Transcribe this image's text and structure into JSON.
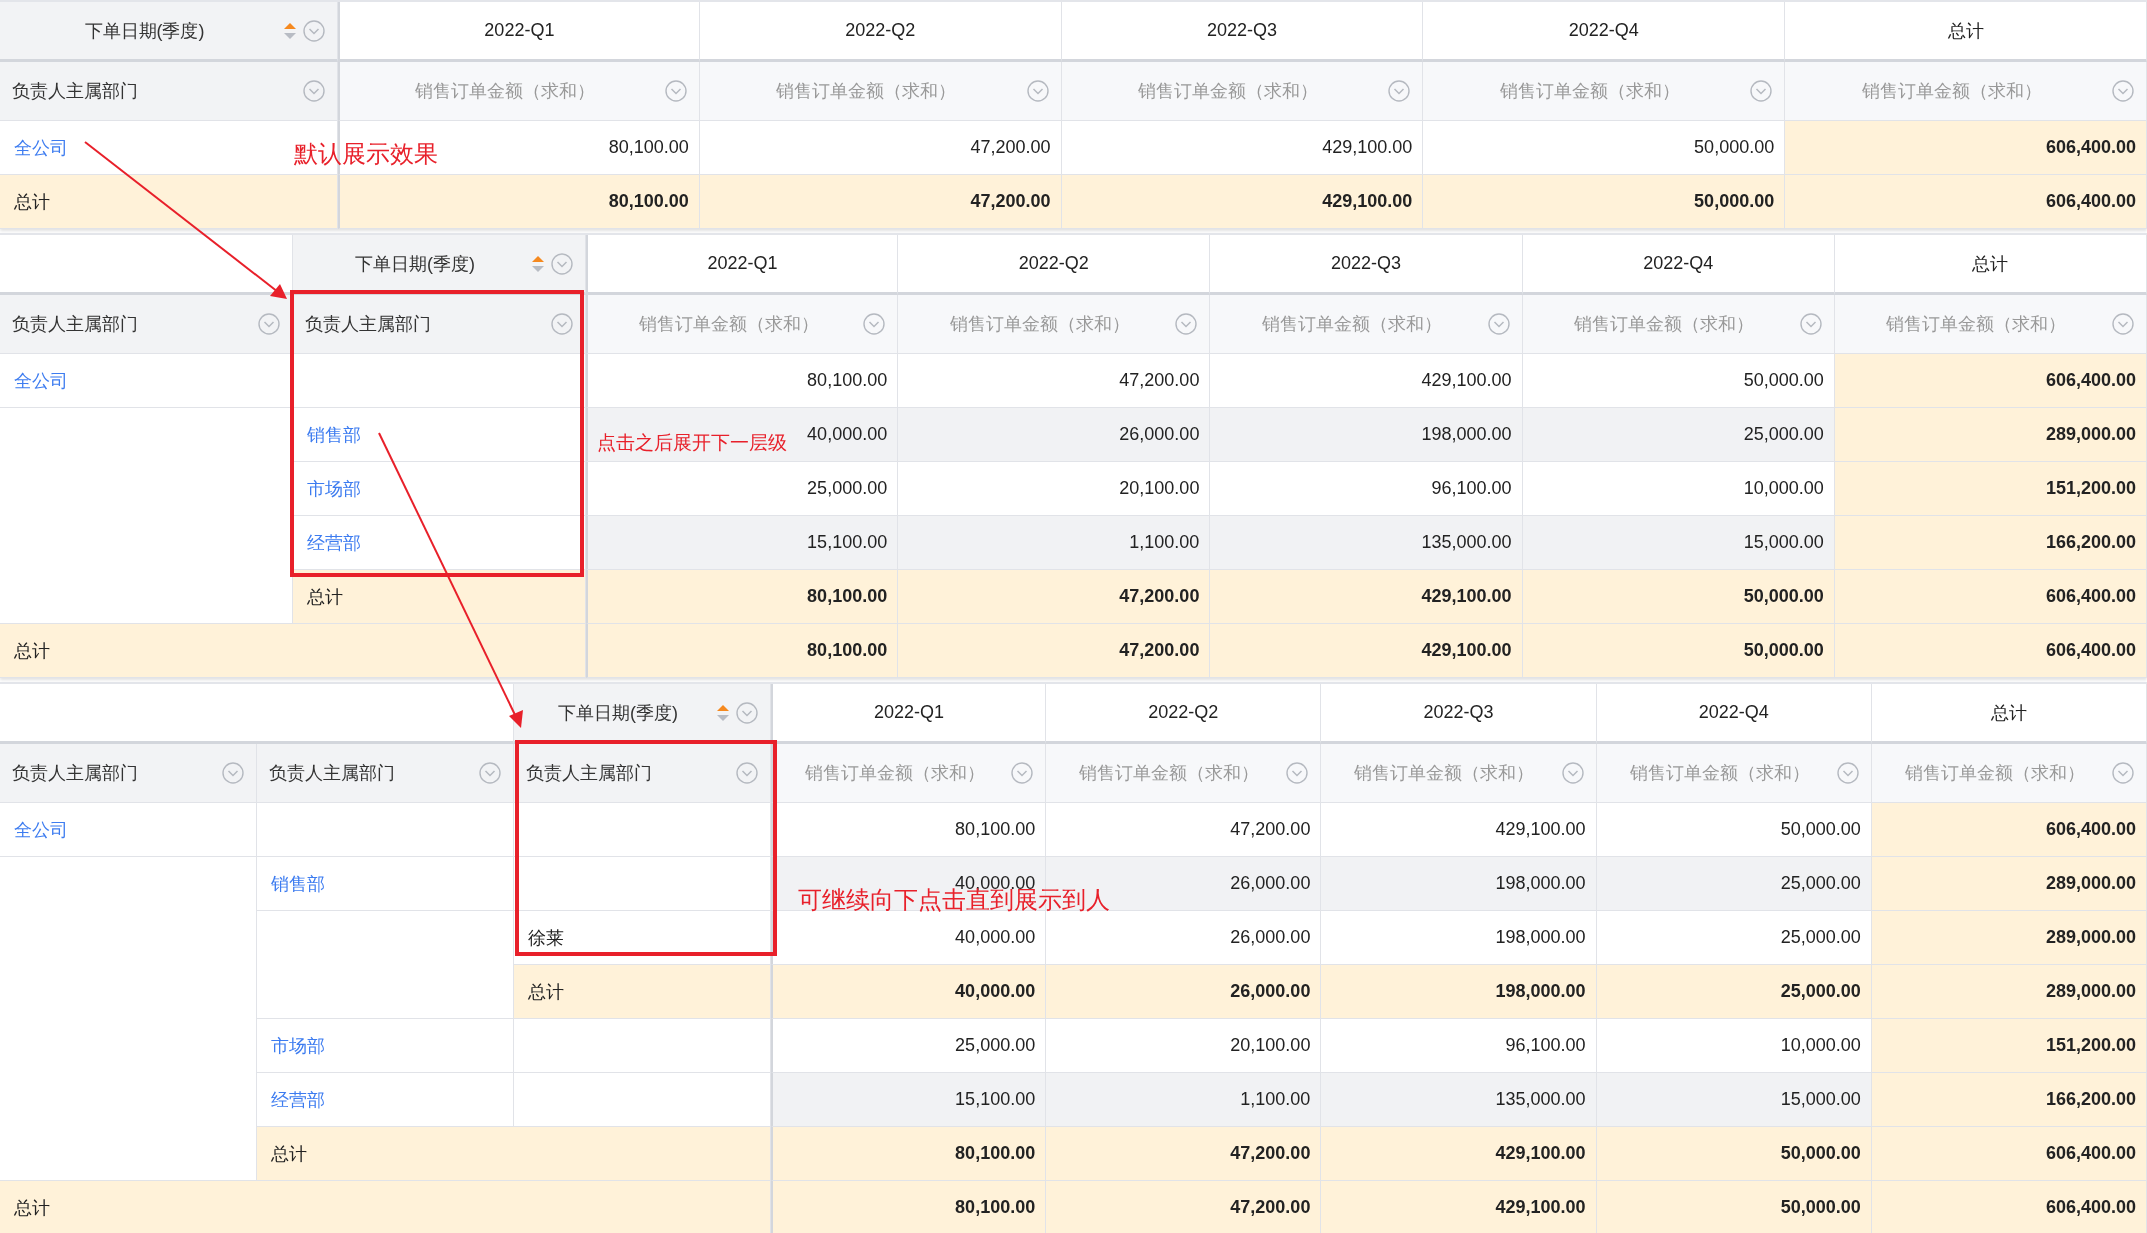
{
  "tables": [
    {
      "date_header": {
        "label": "下单日期(季度)",
        "sort_ascending": true
      },
      "columns": [
        {
          "label": "2022-Q1",
          "measure": "销售订单金额（求和）"
        },
        {
          "label": "2022-Q2",
          "measure": "销售订单金额（求和）"
        },
        {
          "label": "2022-Q3",
          "measure": "销售订单金额（求和）"
        },
        {
          "label": "2022-Q4",
          "measure": "销售订单金额（求和）"
        },
        {
          "label": "总计",
          "measure": "销售订单金额（求和）"
        }
      ],
      "row_dimensions": [
        "负责人主属部门"
      ],
      "rows": [
        {
          "label": "全公司",
          "expandable": true,
          "shaded": false,
          "values": [
            "80,100.00",
            "47,200.00",
            "429,100.00",
            "50,000.00",
            "606,400.00"
          ]
        }
      ],
      "total": {
        "label": "总计",
        "values": [
          "80,100.00",
          "47,200.00",
          "429,100.00",
          "50,000.00",
          "606,400.00"
        ]
      }
    },
    {
      "date_header": {
        "label": "下单日期(季度)",
        "sort_ascending": true
      },
      "columns": [
        {
          "label": "2022-Q1",
          "measure": "销售订单金额（求和）"
        },
        {
          "label": "2022-Q2",
          "measure": "销售订单金额（求和）"
        },
        {
          "label": "2022-Q3",
          "measure": "销售订单金额（求和）"
        },
        {
          "label": "2022-Q4",
          "measure": "销售订单金额（求和）"
        },
        {
          "label": "总计",
          "measure": "销售订单金额（求和）"
        }
      ],
      "row_dimensions": [
        "负责人主属部门",
        "负责人主属部门"
      ],
      "rows": [
        {
          "label": "全公司",
          "expandable": true,
          "shaded": false,
          "values": [
            "80,100.00",
            "47,200.00",
            "429,100.00",
            "50,000.00",
            "606,400.00"
          ],
          "children": [
            {
              "label": "销售部",
              "expandable": true,
              "shaded": true,
              "values": [
                "40,000.00",
                "26,000.00",
                "198,000.00",
                "25,000.00",
                "289,000.00"
              ]
            },
            {
              "label": "市场部",
              "expandable": true,
              "shaded": false,
              "values": [
                "25,000.00",
                "20,100.00",
                "96,100.00",
                "10,000.00",
                "151,200.00"
              ]
            },
            {
              "label": "经营部",
              "expandable": true,
              "shaded": true,
              "values": [
                "15,100.00",
                "1,100.00",
                "135,000.00",
                "15,000.00",
                "166,200.00"
              ]
            }
          ],
          "subtotal": {
            "label": "总计",
            "values": [
              "80,100.00",
              "47,200.00",
              "429,100.00",
              "50,000.00",
              "606,400.00"
            ]
          }
        }
      ],
      "total": {
        "label": "总计",
        "values": [
          "80,100.00",
          "47,200.00",
          "429,100.00",
          "50,000.00",
          "606,400.00"
        ]
      }
    },
    {
      "date_header": {
        "label": "下单日期(季度)",
        "sort_ascending": true
      },
      "columns": [
        {
          "label": "2022-Q1",
          "measure": "销售订单金额（求和）"
        },
        {
          "label": "2022-Q2",
          "measure": "销售订单金额（求和）"
        },
        {
          "label": "2022-Q3",
          "measure": "销售订单金额（求和）"
        },
        {
          "label": "2022-Q4",
          "measure": "销售订单金额（求和）"
        },
        {
          "label": "总计",
          "measure": "销售订单金额（求和）"
        }
      ],
      "row_dimensions": [
        "负责人主属部门",
        "负责人主属部门",
        "负责人主属部门"
      ],
      "rows": [
        {
          "label": "全公司",
          "expandable": true,
          "shaded": false,
          "values": [
            "80,100.00",
            "47,200.00",
            "429,100.00",
            "50,000.00",
            "606,400.00"
          ],
          "children": [
            {
              "label": "销售部",
              "expandable": true,
              "shaded": true,
              "values": [
                "40,000.00",
                "26,000.00",
                "198,000.00",
                "25,000.00",
                "289,000.00"
              ],
              "children": [
                {
                  "label": "徐莱",
                  "expandable": false,
                  "shaded": false,
                  "values": [
                    "40,000.00",
                    "26,000.00",
                    "198,000.00",
                    "25,000.00",
                    "289,000.00"
                  ]
                }
              ],
              "subtotal": {
                "label": "总计",
                "values": [
                  "40,000.00",
                  "26,000.00",
                  "198,000.00",
                  "25,000.00",
                  "289,000.00"
                ]
              }
            },
            {
              "label": "市场部",
              "expandable": true,
              "shaded": false,
              "values": [
                "25,000.00",
                "20,100.00",
                "96,100.00",
                "10,000.00",
                "151,200.00"
              ]
            },
            {
              "label": "经营部",
              "expandable": true,
              "shaded": true,
              "values": [
                "15,100.00",
                "1,100.00",
                "135,000.00",
                "15,000.00",
                "166,200.00"
              ]
            }
          ],
          "subtotal": {
            "label": "总计",
            "values": [
              "80,100.00",
              "47,200.00",
              "429,100.00",
              "50,000.00",
              "606,400.00"
            ]
          }
        }
      ],
      "total": {
        "label": "总计",
        "values": [
          "80,100.00",
          "47,200.00",
          "429,100.00",
          "50,000.00",
          "606,400.00"
        ]
      }
    }
  ],
  "annotations": [
    "默认展示效果",
    "点击之后展开下一层级",
    "可继续向下点击直到展示到人"
  ]
}
